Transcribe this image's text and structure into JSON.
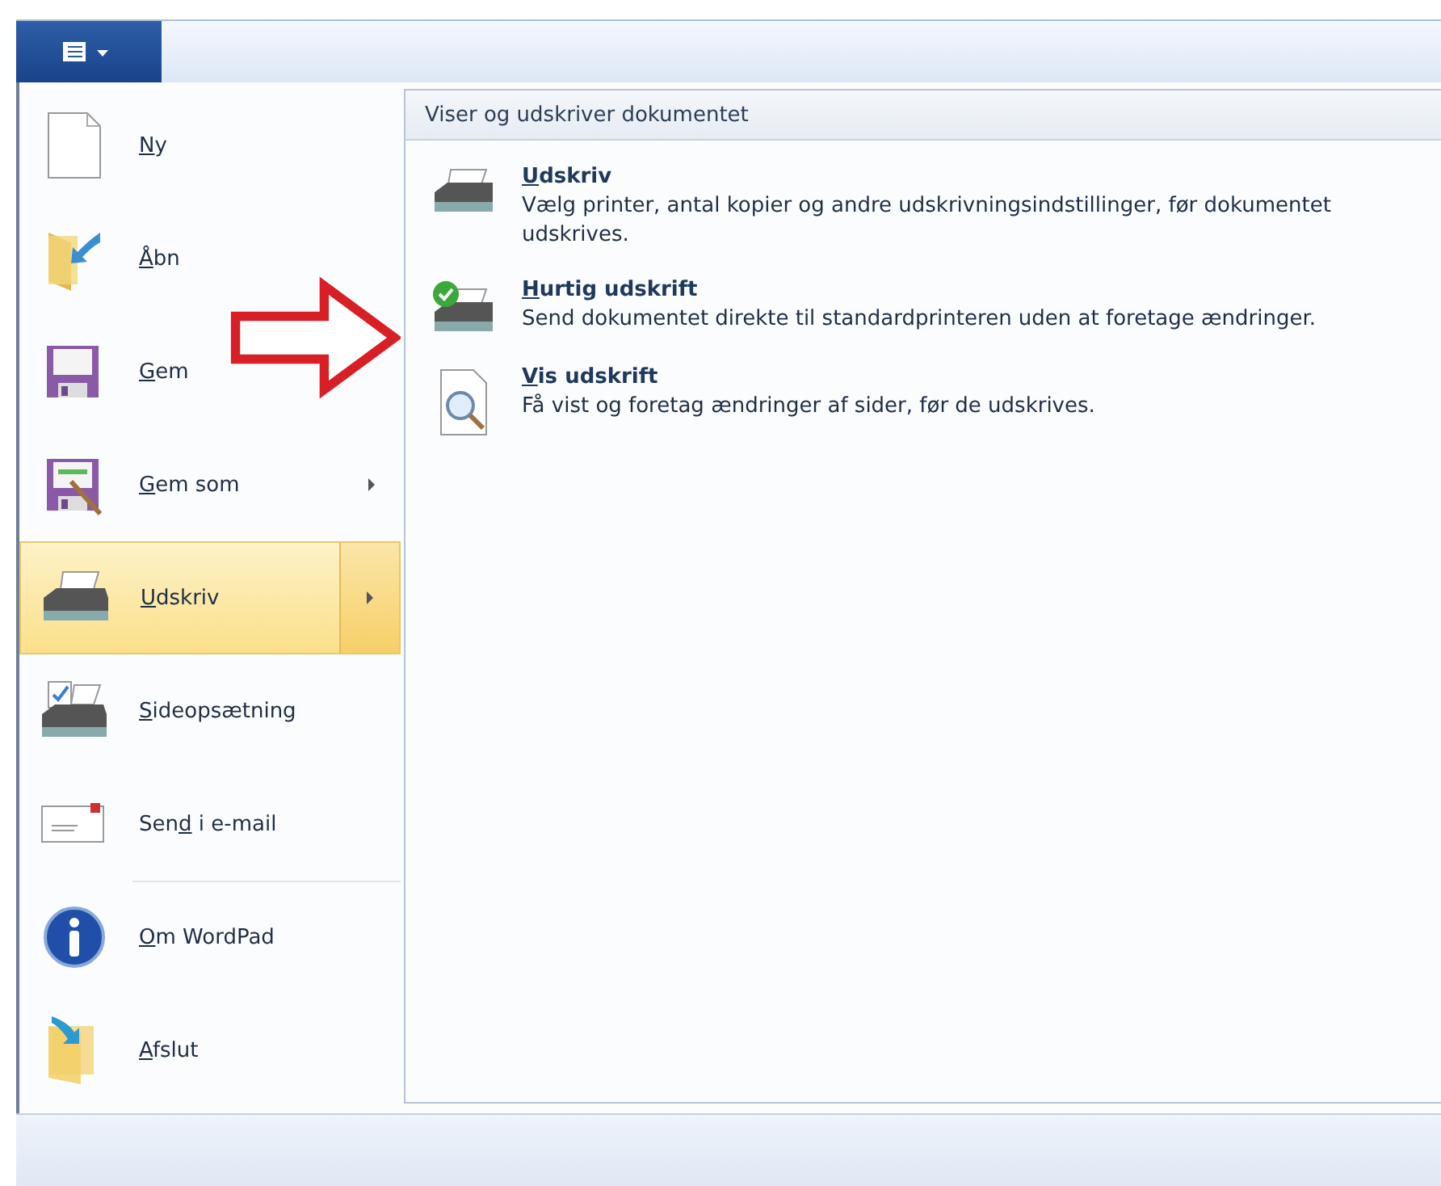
{
  "app_menu_button": {
    "expanded": true
  },
  "menu_items": [
    {
      "kind": "document",
      "label": {
        "key": "N",
        "after": "y"
      },
      "selected": false,
      "submenu": false,
      "separator_before": false
    },
    {
      "kind": "open",
      "label": {
        "key": "Å",
        "after": "bn"
      },
      "selected": false,
      "submenu": false,
      "separator_before": false
    },
    {
      "kind": "save",
      "label": {
        "key": "G",
        "after": "em"
      },
      "selected": false,
      "submenu": false,
      "separator_before": false
    },
    {
      "kind": "save-as",
      "label": {
        "key": "G",
        "after": "em som"
      },
      "selected": false,
      "submenu": true,
      "separator_before": false
    },
    {
      "kind": "printer",
      "label": {
        "key": "U",
        "after": "dskriv"
      },
      "selected": true,
      "submenu": true,
      "separator_before": false
    },
    {
      "kind": "page-setup",
      "label": {
        "key": "S",
        "after": "ideopsætning"
      },
      "selected": false,
      "submenu": false,
      "separator_before": false
    },
    {
      "kind": "email",
      "label": {
        "before": "Sen",
        "key": "d",
        "after": " i e-mail"
      },
      "selected": false,
      "submenu": false,
      "separator_before": false
    },
    {
      "kind": "info",
      "label": {
        "key": "O",
        "after": "m WordPad"
      },
      "selected": false,
      "submenu": false,
      "separator_before": true
    },
    {
      "kind": "exit",
      "label": {
        "key": "A",
        "after": "fslut"
      },
      "selected": false,
      "submenu": false,
      "separator_before": false
    }
  ],
  "submenu": {
    "title": "Viser og udskriver dokumentet",
    "items": [
      {
        "kind": "printer",
        "label": {
          "key": "U",
          "after": "dskriv"
        },
        "description": "Vælg printer, antal kopier og andre udskrivningsindstillinger, før dokumentet udskrives."
      },
      {
        "kind": "quick-print",
        "label": {
          "key": "H",
          "after": "urtig udskrift"
        },
        "description": "Send dokumentet direkte til standardprinteren uden at foretage ændringer."
      },
      {
        "kind": "preview",
        "label": {
          "key": "V",
          "after": "is udskrift"
        },
        "description": "Få vist og foretag ændringer af sider, før de udskrives."
      }
    ]
  },
  "annotation": {
    "kind": "arrow"
  }
}
